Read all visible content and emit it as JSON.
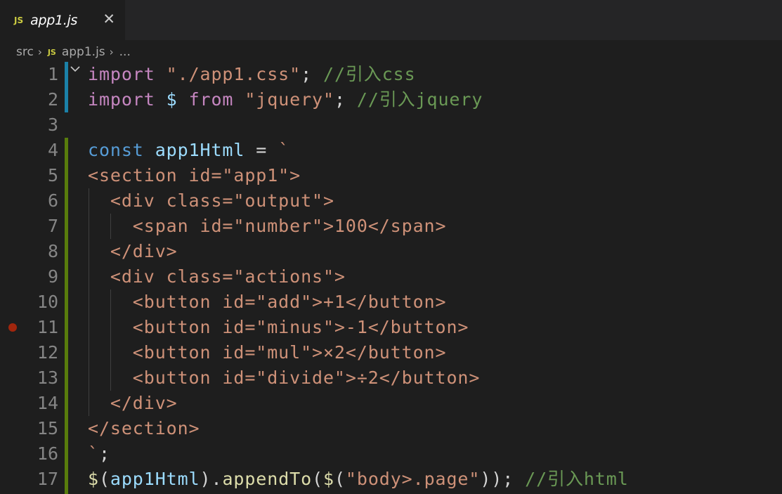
{
  "tab": {
    "badge": "JS",
    "label": "app1.js",
    "close": "✕"
  },
  "breadcrumb": {
    "folder": "src",
    "sep": "›",
    "badge": "JS",
    "file": "app1.js",
    "more": "..."
  },
  "lines": [
    {
      "n": "1"
    },
    {
      "n": "2"
    },
    {
      "n": "3"
    },
    {
      "n": "4"
    },
    {
      "n": "5"
    },
    {
      "n": "6"
    },
    {
      "n": "7"
    },
    {
      "n": "8"
    },
    {
      "n": "9"
    },
    {
      "n": "10"
    },
    {
      "n": "11"
    },
    {
      "n": "12"
    },
    {
      "n": "13"
    },
    {
      "n": "14"
    },
    {
      "n": "15"
    },
    {
      "n": "16"
    },
    {
      "n": "17"
    }
  ],
  "code": {
    "l1": {
      "import": "import",
      "s": " ",
      "str": "\"./app1.css\"",
      "semi": ";",
      "cm": " //引入css"
    },
    "l2": {
      "import": "import",
      "dollar": " $ ",
      "from": "from",
      "s": " ",
      "str": "\"jquery\"",
      "semi": ";",
      "cm": " //引入jquery"
    },
    "l4": {
      "const": "const",
      "name": " app1Html",
      "eq": " = ",
      "tick": "`"
    },
    "l5": "<section id=\"app1\">",
    "l6": "  <div class=\"output\">",
    "l7": "    <span id=\"number\">100</span>",
    "l8": "  </div>",
    "l9": "  <div class=\"actions\">",
    "l10": "    <button id=\"add\">+1</button>",
    "l11": "    <button id=\"minus\">-1</button>",
    "l12": "    <button id=\"mul\">×2</button>",
    "l13": "    <button id=\"divide\">÷2</button>",
    "l14": "  </div>",
    "l15": "</section>",
    "l16": {
      "tick": "`",
      "semi": ";"
    },
    "l17": {
      "d1": "$",
      "p1": "(",
      "v": "app1Html",
      "p2": ").",
      "fn": "appendTo",
      "p3": "(",
      "d2": "$",
      "p4": "(",
      "str": "\"body>.page\"",
      "p5": "));",
      "cm": " //引入html"
    }
  },
  "colors": {
    "keyword": "#c586c0",
    "string": "#ce9178",
    "comment": "#6a9955",
    "storage": "#569cd6",
    "variable": "#9cdcfe",
    "function": "#dcdcaa"
  }
}
